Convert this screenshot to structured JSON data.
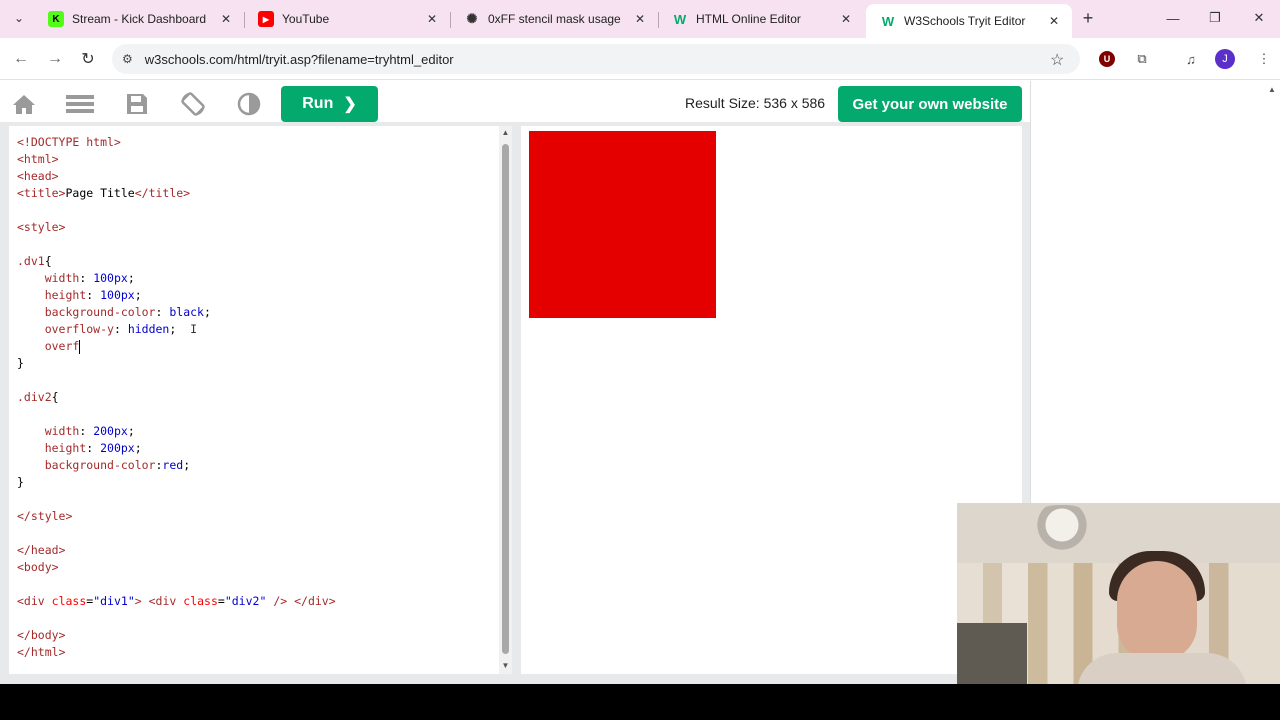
{
  "browser": {
    "tabs": [
      {
        "title": "Stream - Kick Dashboard",
        "icon": "kick-icon",
        "fav_bg": "#53fc18",
        "fav_fg": "#000",
        "fav_text": "K"
      },
      {
        "title": "YouTube",
        "icon": "youtube-icon",
        "fav_bg": "#ff0000",
        "fav_fg": "#fff",
        "fav_text": "▶"
      },
      {
        "title": "0xFF stencil mask usage",
        "icon": "chatgpt-icon",
        "fav_bg": "transparent",
        "fav_fg": "#333",
        "fav_text": "✺"
      },
      {
        "title": "HTML Online Editor",
        "icon": "w3schools-icon",
        "fav_bg": "transparent",
        "fav_fg": "#04aa6d",
        "fav_text": "W"
      },
      {
        "title": "W3Schools Tryit Editor",
        "icon": "w3schools-icon",
        "fav_bg": "transparent",
        "fav_fg": "#04aa6d",
        "fav_text": "W"
      }
    ],
    "url": "w3schools.com/html/tryit.asp?filename=tryhtml_editor",
    "profile_initial": "J"
  },
  "w3": {
    "run_label": "Run",
    "result_size": "Result Size: 536 x 586",
    "own_site_label": "Get your own website",
    "accent": "#04aa6d"
  },
  "result": {
    "box_color": "#e50000"
  }
}
